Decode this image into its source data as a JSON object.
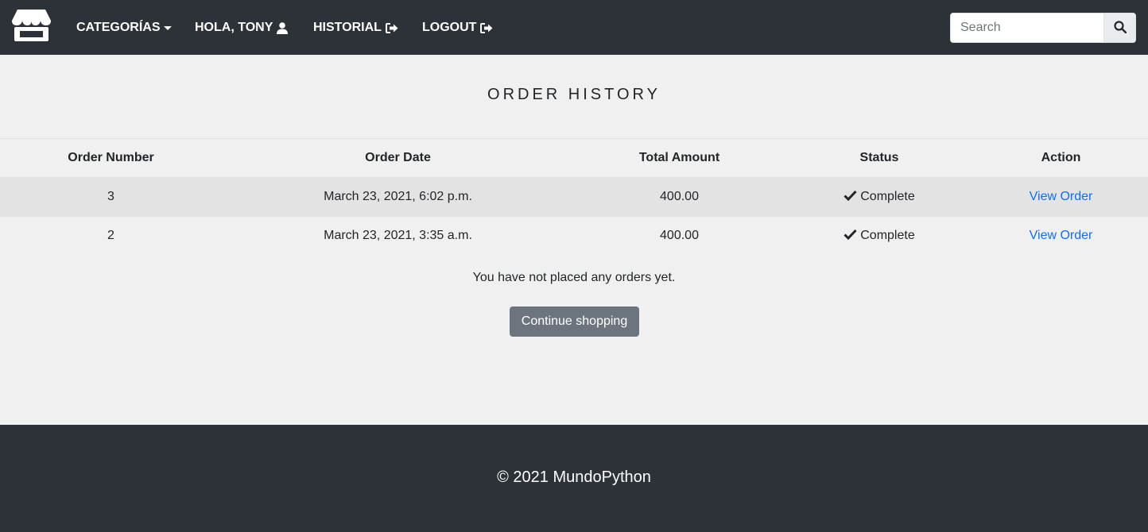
{
  "navbar": {
    "logo_icon": "store-icon",
    "items": [
      {
        "label": "CATEGORÍAS",
        "icon": "caret-down-icon"
      },
      {
        "label": "HOLA, TONY",
        "icon": "user-icon"
      },
      {
        "label": "HISTORIAL",
        "icon": "sign-out-icon"
      },
      {
        "label": "LOGOUT",
        "icon": "sign-out-icon"
      }
    ],
    "search": {
      "placeholder": "Search",
      "value": "",
      "button_icon": "search-icon"
    }
  },
  "main": {
    "title": "ORDER HISTORY",
    "table": {
      "columns": [
        "Order Number",
        "Order Date",
        "Total Amount",
        "Status",
        "Action"
      ],
      "rows": [
        {
          "number": "3",
          "date": "March 23, 2021, 6:02 p.m.",
          "total": "400.00",
          "status": "Complete",
          "action": "View Order"
        },
        {
          "number": "2",
          "date": "March 23, 2021, 3:35 a.m.",
          "total": "400.00",
          "status": "Complete",
          "action": "View Order"
        }
      ]
    },
    "empty_message": "You have not placed any orders yet.",
    "continue_label": "Continue shopping"
  },
  "footer": {
    "text": "© 2021 MundoPython"
  },
  "colors": {
    "navbar_bg": "#2d3238",
    "page_bg": "#f0f0f0",
    "link": "#0d6efd",
    "button_bg": "#6c757d"
  }
}
